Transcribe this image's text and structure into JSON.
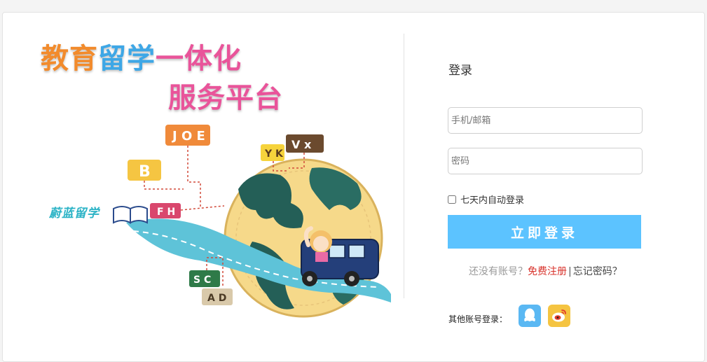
{
  "hero": {
    "title_line1_part1": "教育",
    "title_line1_part2": "留学",
    "title_line1_part3": "一体化",
    "title_line2": "服务平台",
    "brand_text": "蔚蓝留学",
    "icon": "globe-road-bus-illustration"
  },
  "login": {
    "title": "登录",
    "username_placeholder": "手机/邮箱",
    "password_placeholder": "密码",
    "remember_label": "七天内自动登录",
    "remember_checked": false,
    "submit_label": "立即登录",
    "no_account_text": "还没有账号？",
    "register_link": "免费注册",
    "separator": "|",
    "forgot_link": "忘记密码？",
    "other_login_label": "其他账号登录：",
    "social": [
      {
        "icon": "qq-icon",
        "color": "#5ab8f3"
      },
      {
        "icon": "weibo-icon",
        "color": "#f5c441"
      }
    ]
  },
  "colors": {
    "accent_button": "#5cc3ff",
    "register_link": "#d8322b",
    "title_orange": "#f28b2c",
    "title_blue": "#3ea7e6",
    "title_pink": "#e9549a"
  }
}
